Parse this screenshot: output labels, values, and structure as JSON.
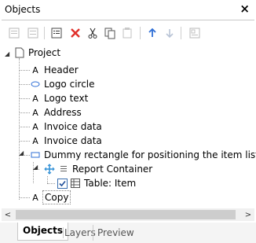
{
  "panel": {
    "title": "Objects",
    "close_glyph": "×"
  },
  "toolbar": {
    "buttons": [
      {
        "name": "new-object-icon",
        "enabled": false
      },
      {
        "name": "new-object-alt-icon",
        "enabled": false
      },
      {
        "name": "properties-icon",
        "enabled": true
      },
      {
        "name": "delete-icon",
        "enabled": true,
        "color": "#e0302a"
      },
      {
        "name": "cut-icon",
        "enabled": true
      },
      {
        "name": "copy-icon",
        "enabled": true
      },
      {
        "name": "paste-icon",
        "enabled": false
      },
      {
        "name": "move-up-icon",
        "enabled": true,
        "color": "#2f6fd6"
      },
      {
        "name": "move-down-icon",
        "enabled": false
      },
      {
        "name": "layout-icon",
        "enabled": false
      }
    ]
  },
  "tree": {
    "items": [
      {
        "label": "Project",
        "icon": "page-icon"
      },
      {
        "label": "Header",
        "icon": "text-object-icon"
      },
      {
        "label": "Logo circle",
        "icon": "ellipse-icon"
      },
      {
        "label": "Logo text",
        "icon": "text-object-icon"
      },
      {
        "label": "Address",
        "icon": "text-object-icon"
      },
      {
        "label": "Invoice data",
        "icon": "text-object-icon"
      },
      {
        "label": "Invoice data",
        "icon": "text-object-icon"
      },
      {
        "label": "Dummy rectangle for positioning the item list",
        "icon": "rectangle-icon"
      },
      {
        "label": "Report Container",
        "icon": "report-container-icon"
      },
      {
        "label": "Table: Item",
        "icon": "table-icon"
      },
      {
        "label": "Copy",
        "icon": "text-object-icon"
      }
    ],
    "text_glyph": "A"
  },
  "scrollbar": {
    "left_glyph": "<",
    "right_glyph": ">"
  },
  "tabs": [
    {
      "label": "Objects",
      "active": true
    },
    {
      "label": "Layers",
      "active": false
    },
    {
      "label": "Preview",
      "active": false
    }
  ]
}
